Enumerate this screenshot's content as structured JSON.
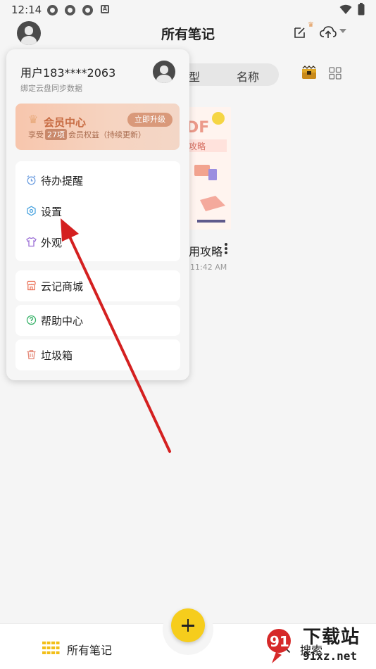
{
  "status_bar": {
    "time": "12:14"
  },
  "header": {
    "title": "所有笔记",
    "crown_glyph": "♛",
    "icons": [
      "avatar-icon",
      "edit-note-icon",
      "crown-icon",
      "cloud-upload-icon",
      "dropdown-caret-icon"
    ]
  },
  "background": {
    "sort_partial_label": "型",
    "sort_name_label": "名称",
    "note_title_partial": "用攻略",
    "note_time_partial": "11:42 AM",
    "thumb_text_1": "DF",
    "thumb_text_2": "攻略"
  },
  "drawer": {
    "username": "用户183****2063",
    "subtitle": "绑定云盘同步数据",
    "vip": {
      "crown_glyph": "♛",
      "title": "会员中心",
      "upgrade_label": "立即升级",
      "desc_prefix": "享受",
      "desc_count": "27项",
      "desc_suffix": "会员权益（持续更新）"
    },
    "menu_group_1": [
      {
        "label": "待办提醒",
        "icon": "alarm-clock-icon"
      },
      {
        "label": "设置",
        "icon": "gear-icon"
      },
      {
        "label": "外观",
        "icon": "tshirt-icon"
      }
    ],
    "menu_store": {
      "label": "云记商城",
      "icon": "store-icon"
    },
    "menu_help": {
      "label": "帮助中心",
      "icon": "help-icon"
    },
    "menu_trash": {
      "label": "垃圾箱",
      "icon": "trash-icon"
    }
  },
  "bottom_bar": {
    "notes_label": "所有笔记",
    "search_label": "搜索",
    "fab": "add-note-button"
  },
  "watermark": {
    "title": "下载站",
    "site": "91xz.net",
    "logo_digits": "91"
  },
  "colors": {
    "accent_yellow": "#f6cd1c",
    "arrow_red": "#d42020",
    "vip_text": "#c76b42"
  }
}
